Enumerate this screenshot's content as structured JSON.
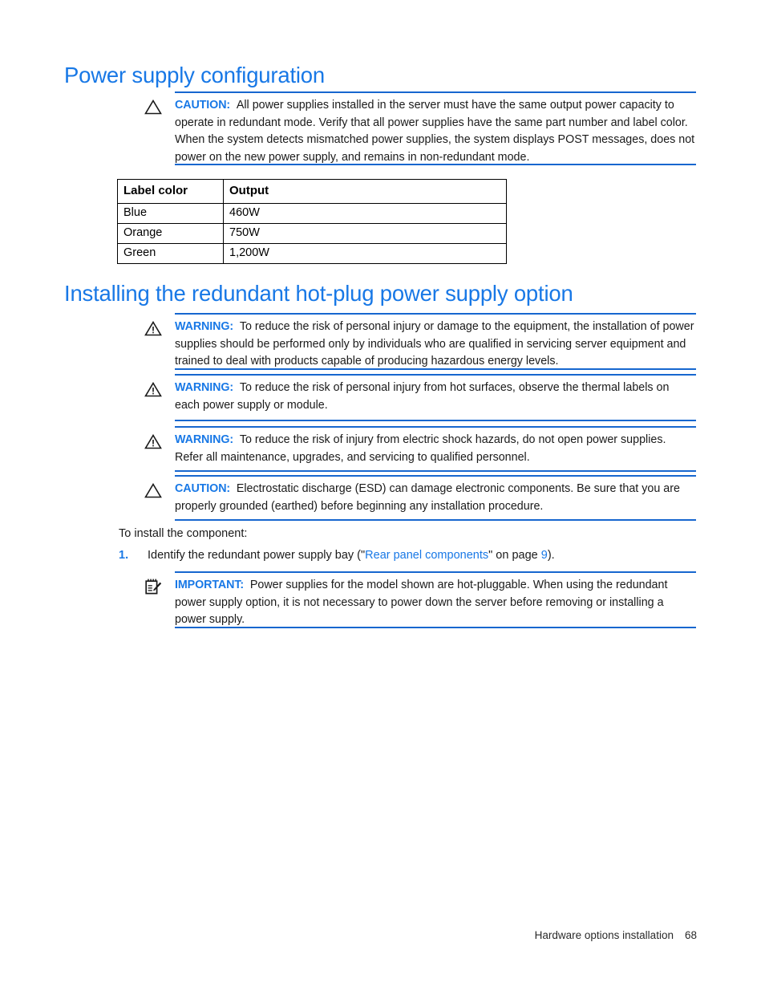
{
  "document": {
    "headings": {
      "power_supply_configuration": "Power supply configuration",
      "installing_option": "Installing the redundant hot-plug power supply option"
    },
    "accent_color": "#1878e6",
    "rule_color": "#1767cf"
  },
  "notes": [
    {
      "id": "caution-mixed-supplies",
      "icon": "caution-triangle-icon",
      "label": "CAUTION:",
      "text": "All power supplies installed in the server must have the same output power capacity to operate in redundant mode. Verify that all power supplies have the same part number and label color. When the system detects mismatched power supplies, the system displays POST messages, does not power on the new power supply, and remains in non-redundant mode."
    },
    {
      "id": "warning-qualified-personnel",
      "icon": "warning-triangle-icon",
      "label": "WARNING:",
      "text": "To reduce the risk of personal injury or damage to the equipment, the installation of power supplies should be performed only by individuals who are qualified in servicing server equipment and trained to deal with products capable of producing hazardous energy levels."
    },
    {
      "id": "warning-hot-surfaces",
      "icon": "warning-triangle-icon",
      "label": "WARNING:",
      "text": "To reduce the risk of personal injury from hot surfaces, observe the thermal labels on each power supply or module."
    },
    {
      "id": "warning-electric-shock",
      "icon": "warning-triangle-icon",
      "label": "WARNING:",
      "text": "To reduce the risk of injury from electric shock hazards, do not open power supplies. Refer all maintenance, upgrades, and servicing to qualified personnel."
    },
    {
      "id": "caution-esd",
      "icon": "caution-triangle-icon",
      "label": "CAUTION:",
      "text": "Electrostatic discharge (ESD) can damage electronic components. Be sure that you are properly grounded (earthed) before beginning any installation procedure."
    },
    {
      "id": "important-hot-pluggable",
      "icon": "important-notepad-icon",
      "label": "IMPORTANT:",
      "text": "Power supplies for the model shown are hot-pluggable. When using the redundant power supply option, it is not necessary to power down the server before removing or installing a power supply."
    }
  ],
  "table": {
    "headers": [
      "Label color",
      "Output"
    ],
    "rows": [
      [
        "Blue",
        "460W"
      ],
      [
        "Orange",
        "750W"
      ],
      [
        "Green",
        "1,200W"
      ]
    ]
  },
  "procedure": {
    "intro": "To install the component:",
    "steps": [
      {
        "number": "1.",
        "text_before": "Identify the redundant power supply bay (\"",
        "link_text": "Rear panel components",
        "text_middle": "\" on page ",
        "page_ref": "9",
        "text_after": ")."
      }
    ]
  },
  "footer": {
    "chapter": "Hardware options installation",
    "page_number": "68"
  }
}
